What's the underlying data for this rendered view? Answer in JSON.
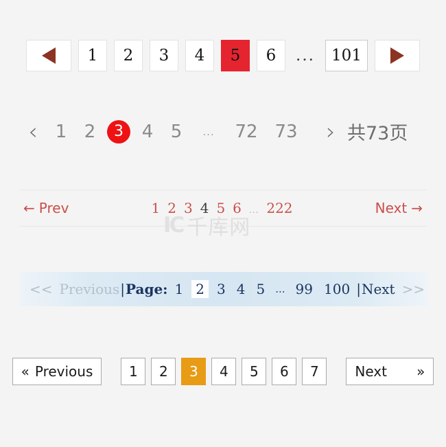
{
  "pagers": {
    "boxed_red": {
      "prev_icon": "triangle-left-icon",
      "next_icon": "triangle-right-icon",
      "pages": [
        "1",
        "2",
        "3",
        "4",
        "5",
        "6"
      ],
      "ellipsis": "...",
      "last_page": "101",
      "current": "5",
      "accent": "#e4242f",
      "arrow_color": "#8c3323"
    },
    "flat_dot": {
      "prev_icon": "chevron-left-icon",
      "next_icon": "chevron-right-icon",
      "prev_glyph": "‹",
      "next_glyph": "›",
      "pages_before": [
        "1",
        "2"
      ],
      "current": "3",
      "pages_after": [
        "4",
        "5"
      ],
      "ellipsis": "...",
      "tail_pages": [
        "72",
        "73"
      ],
      "total_label": "共73页",
      "accent": "#ee1214"
    },
    "prev_next_red": {
      "prev_arrow": "←",
      "prev_label": "Prev",
      "next_label": "Next",
      "next_arrow": "→",
      "pages": [
        "1",
        "2",
        "3",
        "4",
        "5",
        "6"
      ],
      "ellipsis": "...",
      "last_page": "222",
      "current": "4",
      "accent": "#c94f4a"
    },
    "blue_bar": {
      "prev_chevrons": "<<",
      "prev_label": "Previous",
      "sep_left": "|",
      "page_label": "Page:",
      "pages": [
        "1",
        "2",
        "3",
        "4",
        "5"
      ],
      "ellipsis": "...",
      "tail_pages": [
        "99",
        "100"
      ],
      "current": "2",
      "sep_right": "|",
      "next_label": "Next",
      "next_chevrons": ">>",
      "accent": "#1b3560"
    },
    "boxed_orange": {
      "prev_glyph": "«",
      "prev_label": "Previous",
      "pages": [
        "1",
        "2",
        "3",
        "4",
        "5",
        "6",
        "7"
      ],
      "current": "3",
      "next_label": "Next",
      "next_glyph": "»",
      "accent": "#e89b15"
    }
  },
  "watermark": {
    "mark": "IC",
    "text": "千库网"
  }
}
